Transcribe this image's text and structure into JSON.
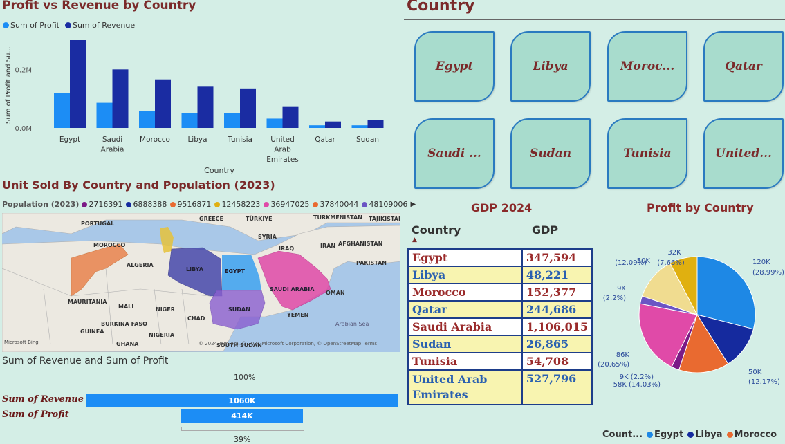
{
  "bar_chart": {
    "title": "Profit vs Revenue by Country",
    "legend": [
      {
        "label": "Sum of Profit",
        "color": "#1c8df5"
      },
      {
        "label": "Sum of Revenue",
        "color": "#1a2ca2"
      }
    ],
    "ylabel": "Sum of Profit and Su...",
    "xlabel": "Country",
    "ticks": [
      "0.2M",
      "0.0M"
    ]
  },
  "chart_data": [
    {
      "type": "bar",
      "title": "Profit vs Revenue by Country",
      "xlabel": "Country",
      "ylabel": "Sum of Profit and Su...",
      "categories": [
        "Egypt",
        "Saudi Arabia",
        "Morocco",
        "Libya",
        "Tunisia",
        "United Arab Emirates",
        "Qatar",
        "Sudan"
      ],
      "category_labels": [
        [
          "Egypt"
        ],
        [
          "Saudi",
          "Arabia"
        ],
        [
          "Morocco"
        ],
        [
          "Libya"
        ],
        [
          "Tunisia"
        ],
        [
          "United",
          "Arab",
          "Emirates"
        ],
        [
          "Qatar"
        ],
        [
          "Sudan"
        ]
      ],
      "series": [
        {
          "name": "Sum of Profit",
          "color": "#1c8df5",
          "values": [
            120000,
            86000,
            58000,
            50000,
            50000,
            32000,
            9000,
            9000
          ]
        },
        {
          "name": "Sum of Revenue",
          "color": "#1a2ca2",
          "values": [
            300000,
            200000,
            166000,
            141000,
            135000,
            74000,
            22000,
            26000
          ]
        }
      ],
      "ylim": [
        0,
        300000
      ],
      "yticks": [
        {
          "value": 0,
          "label": "0.0M"
        },
        {
          "value": 200000,
          "label": "0.2M"
        }
      ]
    },
    {
      "type": "pie",
      "title": "Profit by Country",
      "legend_title": "Count...",
      "slices": [
        {
          "label": "Egypt",
          "value": 120000,
          "text": "120K",
          "pct": "(28.99%)",
          "color": "#1e88e5"
        },
        {
          "label": "Libya",
          "value": 50000,
          "text": "50K",
          "pct": "(12.17%)",
          "color": "#152a9e"
        },
        {
          "label": "Morocco",
          "value": 58000,
          "text": "58K (14.03%)",
          "pct": "",
          "color": "#e96a30"
        },
        {
          "label": "Sudan",
          "value": 9000,
          "text": "9K (2.2%)",
          "pct": "",
          "color": "#7b1a86"
        },
        {
          "label": "Saudi Arabia",
          "value": 86000,
          "text": "86K",
          "pct": "(20.65%)",
          "color": "#e04aa8"
        },
        {
          "label": "Qatar",
          "value": 9000,
          "text": "9K",
          "pct": "(2.2%)",
          "color": "#6b55c4"
        },
        {
          "label": "Tunisia",
          "value": 50000,
          "text": "50K",
          "pct": "(12.09%)",
          "color": "#f0dc90"
        },
        {
          "label": "United Arab Emirates",
          "value": 32000,
          "text": "32K",
          "pct": "(7.66%)",
          "color": "#e0b010"
        }
      ]
    },
    {
      "type": "bar",
      "title": "Sum of Revenue and Sum of Profit",
      "categories": [
        "Sum of Revenue",
        "Sum of Profit"
      ],
      "values": [
        1060000,
        414000
      ],
      "value_labels": [
        "1060K",
        "414K"
      ],
      "percent_labels": [
        "100%",
        "39%"
      ]
    }
  ],
  "slicer": {
    "title": "Country",
    "tiles": [
      "Egypt",
      "Libya",
      "Moroc...",
      "Qatar",
      "Saudi ...",
      "Sudan",
      "Tunisia",
      "United..."
    ]
  },
  "map": {
    "title": "Unit Sold By Country and Population (2023)",
    "legend_title": "Population (2023)",
    "legend": [
      {
        "label": "2716391",
        "color": "#7b1a86"
      },
      {
        "label": "6888388",
        "color": "#152a9e"
      },
      {
        "label": "9516871",
        "color": "#e96a30"
      },
      {
        "label": "12458223",
        "color": "#e0b010"
      },
      {
        "label": "36947025",
        "color": "#e04aa8"
      },
      {
        "label": "37840044",
        "color": "#e96a30"
      },
      {
        "label": "48109006",
        "color": "#6b55c4"
      }
    ],
    "labels": [
      "PORTUGAL",
      "GREECE",
      "TÜRKIYE",
      "TURKMENISTAN",
      "TAJIKISTAN",
      "SYRIA",
      "MOROCCO",
      "IRAQ",
      "IRAN",
      "AFGHANISTAN",
      "ALGERIA",
      "LIBYA",
      "EGYPT",
      "SAUDI ARABIA",
      "PAKISTAN",
      "OMAN",
      "MAURITANIA",
      "MALI",
      "NIGER",
      "SUDAN",
      "CHAD",
      "YEMEN",
      "Arabian Sea",
      "BURKINA FASO",
      "GUINEA",
      "NIGERIA",
      "GHANA",
      "SOUTH SUDAN"
    ],
    "logo": "Microsoft Bing",
    "copyright": "© 2024 TomTom, © 2024 Microsoft Corporation, © OpenStreetMap",
    "terms": "Terms"
  },
  "funnel": {
    "title": "Sum of Revenue and Sum of Profit",
    "top_pct": "100%",
    "bottom_pct": "39%",
    "rows": [
      {
        "label": "Sum of Revenue",
        "value": "1060K",
        "fraction": 1.0
      },
      {
        "label": "Sum of Profit",
        "value": "414K",
        "fraction": 0.39
      }
    ]
  },
  "gdp": {
    "title": "GDP 2024",
    "col_country": "Country",
    "col_gdp": "GDP",
    "rows": [
      {
        "country": "Egypt",
        "gdp": "347,594"
      },
      {
        "country": "Libya",
        "gdp": "48,221"
      },
      {
        "country": "Morocco",
        "gdp": "152,377"
      },
      {
        "country": "Qatar",
        "gdp": "244,686"
      },
      {
        "country": "Saudi Arabia",
        "gdp": "1,106,015"
      },
      {
        "country": "Sudan",
        "gdp": "26,865"
      },
      {
        "country": "Tunisia",
        "gdp": "54,708"
      },
      {
        "country": "United Arab Emirates",
        "gdp": "527,796"
      }
    ]
  },
  "pie": {
    "title": "Profit by Country",
    "legend_title": "Count...",
    "legend": [
      {
        "label": "Egypt",
        "color": "#1e88e5"
      },
      {
        "label": "Libya",
        "color": "#152a9e"
      },
      {
        "label": "Morocco",
        "color": "#e96a30"
      }
    ]
  }
}
